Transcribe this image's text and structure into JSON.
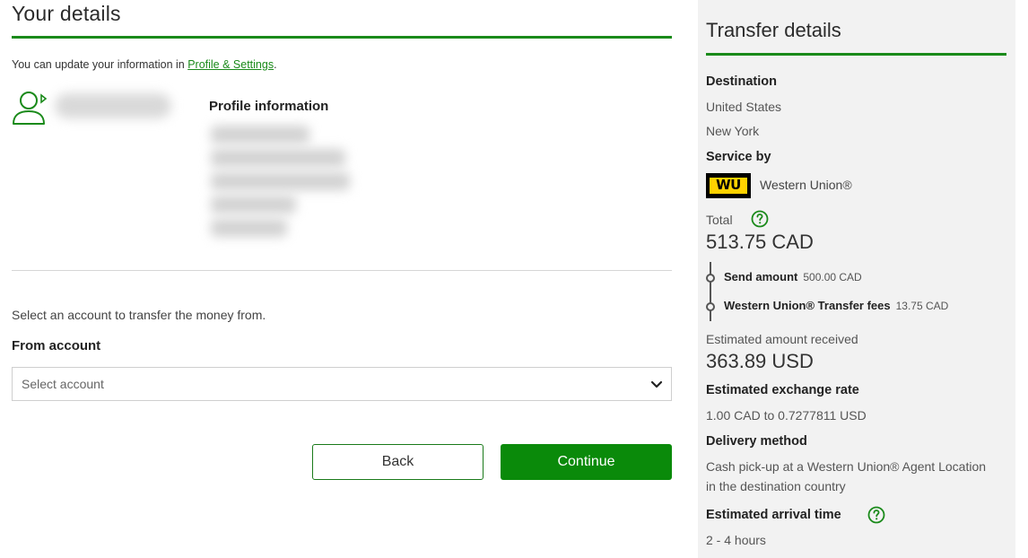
{
  "details": {
    "title": "Your details",
    "update_prefix": "You can update your information in ",
    "update_link": "Profile & Settings",
    "update_suffix": ".",
    "profile_title": "Profile information"
  },
  "account": {
    "prompt": "Select an account to transfer the money from.",
    "label": "From account",
    "placeholder": "Select account"
  },
  "buttons": {
    "back": "Back",
    "continue": "Continue"
  },
  "transfer": {
    "title": "Transfer details",
    "destination_label": "Destination",
    "country": "United States",
    "state": "New York",
    "service_label": "Service by",
    "service_logo": "WU",
    "service_name": "Western Union®",
    "total_label": "Total",
    "total_amount": "513.75 CAD",
    "send_label": "Send amount",
    "send_amount": "500.00 CAD",
    "fees_label": "Western Union® Transfer fees",
    "fees_amount": "13.75 CAD",
    "received_label": "Estimated amount received",
    "received_amount": "363.89 USD",
    "rate_label": "Estimated exchange rate",
    "rate_value": "1.00 CAD to 0.7277811 USD",
    "delivery_label": "Delivery method",
    "delivery_line1": "Cash pick-up at a Western Union® Agent Location",
    "delivery_line2": "in the destination country",
    "arrival_label": "Estimated arrival time",
    "arrival_value": "2 - 4 hours"
  },
  "colors": {
    "accent": "#1a8a1a",
    "button": "#0a8a0a",
    "panel_bg": "#f2f2f2",
    "wu_yellow": "#ffd200"
  },
  "icons": [
    "user-icon",
    "chevron-down-icon",
    "help-icon"
  ]
}
